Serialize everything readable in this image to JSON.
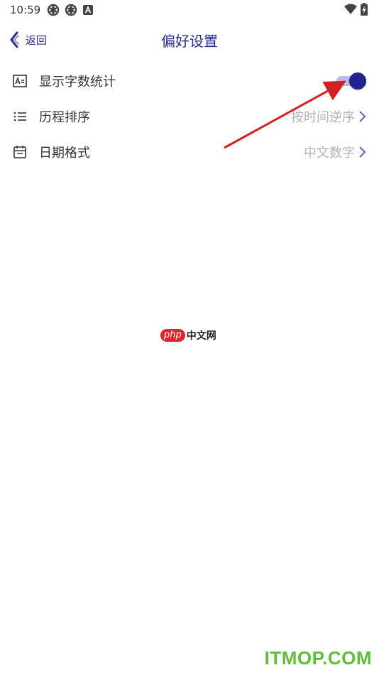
{
  "status_bar": {
    "time": "10:59",
    "icons": [
      "gear-notification-icon",
      "gear-notification-icon",
      "a-notification-icon"
    ],
    "wifi_icon": "wifi-icon",
    "battery_icon": "battery-charging-icon"
  },
  "header": {
    "back_label": "返回",
    "title": "偏好设置"
  },
  "settings": [
    {
      "icon": "word-count-icon",
      "label": "显示字数统计",
      "type": "toggle",
      "enabled": true
    },
    {
      "icon": "list-icon",
      "label": "历程排序",
      "type": "select",
      "value": "按时间逆序"
    },
    {
      "icon": "calendar-icon",
      "label": "日期格式",
      "type": "select",
      "value": "中文数字"
    }
  ],
  "watermarks": {
    "php_badge": "php",
    "php_text": "中文网",
    "itmop": "ITMOP.COM"
  },
  "colors": {
    "accent": "#2a2a8a",
    "toggle_thumb": "#1e2390",
    "toggle_track": "#b9bce8",
    "annotation_arrow": "#d42020"
  }
}
